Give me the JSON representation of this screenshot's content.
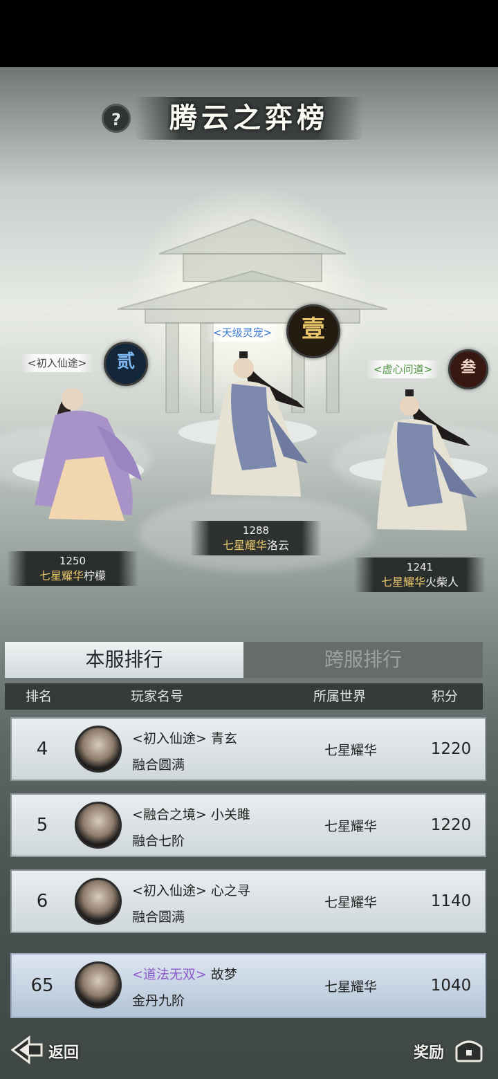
{
  "screen": {
    "title": "腾云之弈榜",
    "help_label": "?"
  },
  "podium": [
    {
      "position_label": "贰",
      "title": "<初入仙途>",
      "score": "1250",
      "server": "七星耀华",
      "player": "柠檬",
      "medal_color": "#2b4f7a",
      "robe_color": "#a893c9"
    },
    {
      "position_label": "壹",
      "title": "<天级灵宠>",
      "score": "1288",
      "server": "七星耀华",
      "player": "洛云",
      "medal_color": "#c9a24a",
      "robe_color": "#7d88ad"
    },
    {
      "position_label": "叁",
      "title": "<虚心问道>",
      "score": "1241",
      "server": "七星耀华",
      "player": "火柴人",
      "medal_color": "#8a3a2a",
      "robe_color": "#7d88ad"
    }
  ],
  "podium_title_colors": {
    "second": "#3d3f3c",
    "first": "#3a7bd1",
    "third": "#4f8f3f"
  },
  "tabs": {
    "local": "本服排行",
    "cross": "跨服排行",
    "active": "local"
  },
  "table": {
    "headers": {
      "rank": "排名",
      "player": "玩家名号",
      "world": "所属世界",
      "score": "积分"
    },
    "rows": [
      {
        "rank": "4",
        "title": "<初入仙途>",
        "name": "青玄",
        "realm": "融合圆满",
        "world": "七星耀华",
        "score": "1220"
      },
      {
        "rank": "5",
        "title": "<融合之境>",
        "name": "小关雎",
        "realm": "融合七阶",
        "world": "七星耀华",
        "score": "1220"
      },
      {
        "rank": "6",
        "title": "<初入仙途>",
        "name": "心之寻",
        "realm": "融合圆满",
        "world": "七星耀华",
        "score": "1140"
      }
    ],
    "self_row": {
      "rank": "65",
      "title": "<道法无双>",
      "name": "故梦",
      "realm": "金丹九阶",
      "world": "七星耀华",
      "score": "1040"
    }
  },
  "footer": {
    "back": "返回",
    "reward": "奖励",
    "back_icon": "back-arrow-icon",
    "reward_icon": "treasure-chest-icon"
  }
}
